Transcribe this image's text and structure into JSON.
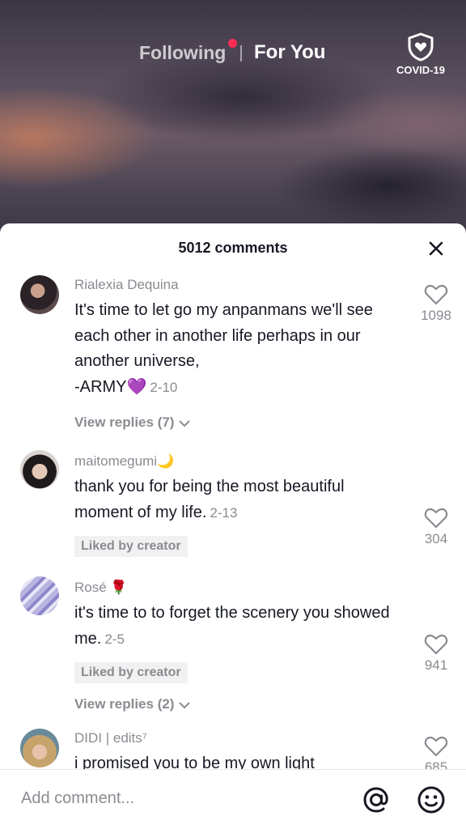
{
  "top_nav": {
    "following_label": "Following",
    "for_you_label": "For You",
    "covid_label": "COVID-19"
  },
  "comments_sheet": {
    "title": "5012 comments",
    "comments": [
      {
        "username": "Rialexia Dequina",
        "text": "It's time to let go my anpanmans we'll see each other in another life perhaps in our another universe,\n-ARMY💜",
        "date": "2-10",
        "likes": "1098",
        "view_replies": "View replies (7)"
      },
      {
        "username": "maitomegumi🌙",
        "text": "thank you for being the most beautiful moment of my life.",
        "date": "2-13",
        "likes": "304",
        "badge": "Liked by creator"
      },
      {
        "username": "Rosé 🌹",
        "text": "it's time to to forget the scenery you showed me.",
        "date": "2-5",
        "likes": "941",
        "badge": "Liked by creator",
        "view_replies": "View replies (2)"
      },
      {
        "username": "DIDI | edits⁷",
        "text": "i promised you to be my own light",
        "likes": "685"
      }
    ]
  },
  "footer": {
    "placeholder": "Add comment..."
  }
}
